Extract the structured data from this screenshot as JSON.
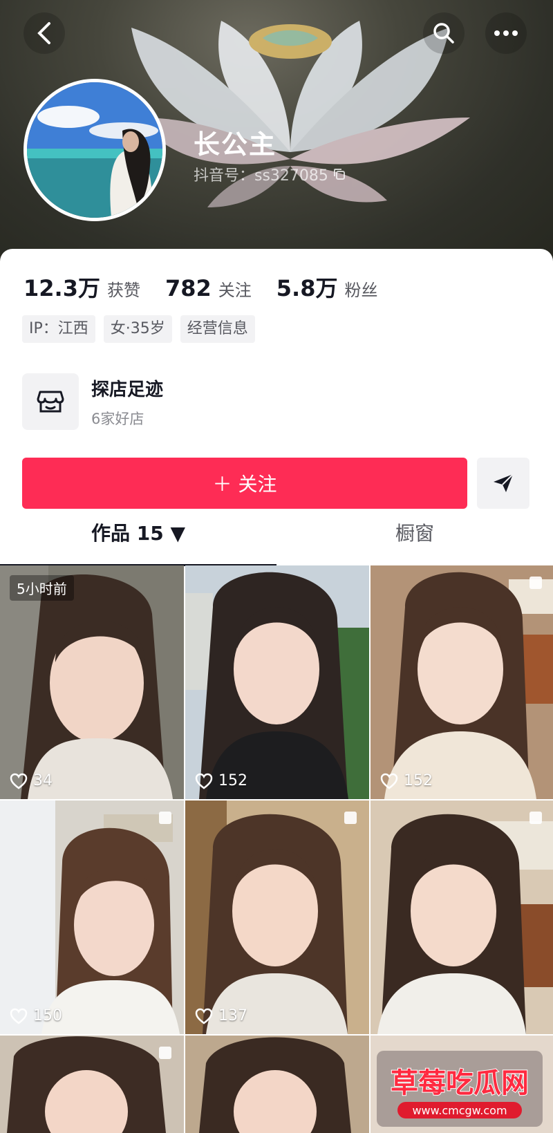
{
  "profile": {
    "name": "长公主",
    "douyin_id": "抖音号：ss327085"
  },
  "stats": [
    {
      "num": "12.3万",
      "label": "获赞"
    },
    {
      "num": "782",
      "label": "关注"
    },
    {
      "num": "5.8万",
      "label": "粉丝"
    }
  ],
  "tags": [
    "IP：江西",
    "女·35岁",
    "经营信息"
  ],
  "shop": {
    "title": "探店足迹",
    "subtitle": "6家好店"
  },
  "actions": {
    "follow": "＋ 关注"
  },
  "tabs": {
    "works": "作品 15 ▼",
    "showcase": "橱窗"
  },
  "videos": [
    {
      "likes": "34",
      "pinned": "5小时前"
    },
    {
      "likes": "152"
    },
    {
      "likes": "152"
    },
    {
      "likes": "150"
    },
    {
      "likes": "137"
    },
    {
      "likes": ""
    }
  ],
  "watermark": {
    "title": "草莓吃瓜网",
    "url": "www.cmcgw.com"
  },
  "colors": {
    "follow": "#fe2c55",
    "text": "#161823",
    "subtext": "#57585f"
  }
}
